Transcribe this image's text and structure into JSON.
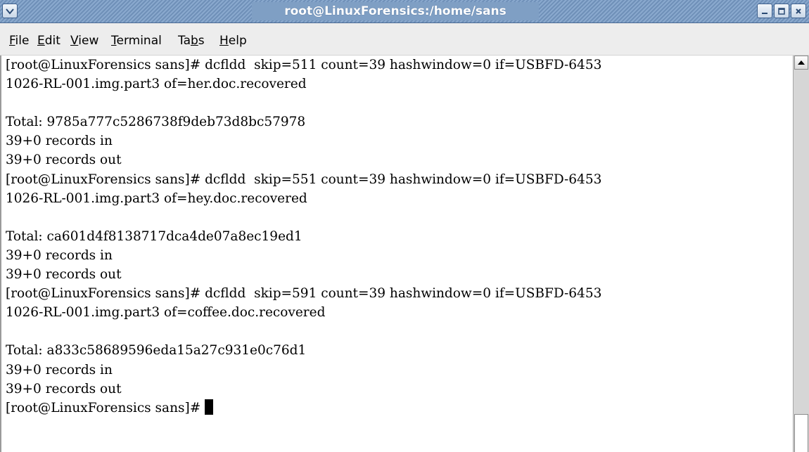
{
  "window": {
    "title": "root@LinuxForensics:/home/sans",
    "controls": [
      "window-menu",
      "minimize",
      "maximize",
      "close"
    ]
  },
  "menubar": {
    "items": [
      {
        "label": "File",
        "mnemonic": "F",
        "rest": "ile"
      },
      {
        "label": "Edit",
        "mnemonic": "E",
        "rest": "dit"
      },
      {
        "label": "View",
        "mnemonic": "V",
        "rest": "iew"
      },
      {
        "label": "Terminal",
        "mnemonic": "T",
        "rest": "erminal"
      },
      {
        "label": "Tabs",
        "pre": "Ta",
        "mnemonic": "b",
        "rest": "s"
      },
      {
        "label": "Help",
        "mnemonic": "H",
        "rest": "elp"
      }
    ]
  },
  "terminal": {
    "lines": [
      "[root@LinuxForensics sans]# dcfldd  skip=511 count=39 hashwindow=0 if=USBFD-6453",
      "1026-RL-001.img.part3 of=her.doc.recovered",
      "",
      "Total: 9785a777c5286738f9deb73d8bc57978",
      "39+0 records in",
      "39+0 records out",
      "[root@LinuxForensics sans]# dcfldd  skip=551 count=39 hashwindow=0 if=USBFD-6453",
      "1026-RL-001.img.part3 of=hey.doc.recovered",
      "",
      "Total: ca601d4f8138717dca4de07a8ec19ed1",
      "39+0 records in",
      "39+0 records out",
      "[root@LinuxForensics sans]# dcfldd  skip=591 count=39 hashwindow=0 if=USBFD-6453",
      "1026-RL-001.img.part3 of=coffee.doc.recovered",
      "",
      "Total: a833c58689596eda15a27c931e0c76d1",
      "39+0 records in",
      "39+0 records out"
    ],
    "prompt": "[root@LinuxForensics sans]# "
  },
  "colors": {
    "titlebar": "#7f9fc4",
    "menubar": "#ededed",
    "terminal_bg": "#ffffff",
    "terminal_fg": "#000000"
  }
}
